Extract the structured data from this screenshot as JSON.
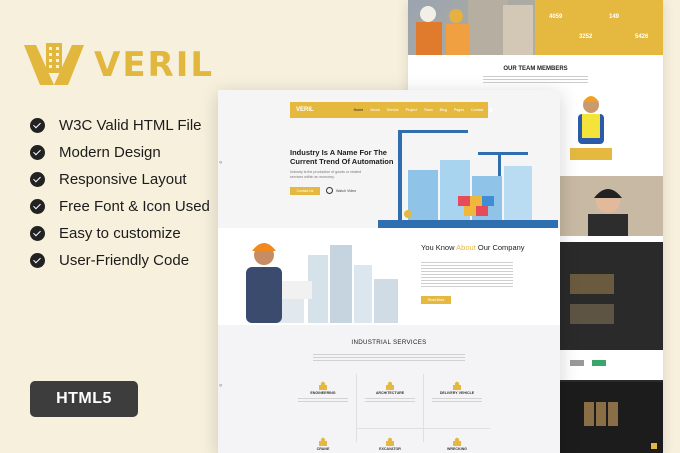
{
  "brand": {
    "name": "VERIL",
    "accent": "#e5b940",
    "logo_color": "#e2b73e"
  },
  "features": [
    {
      "label": "W3C Valid HTML File",
      "icon": "check-circle-icon"
    },
    {
      "label": "Modern Design",
      "icon": "check-circle-icon"
    },
    {
      "label": "Responsive Layout",
      "icon": "check-circle-icon"
    },
    {
      "label": "Free Font & Icon Used",
      "icon": "check-circle-icon"
    },
    {
      "label": "Easy to customize",
      "icon": "check-circle-icon"
    },
    {
      "label": "User-Friendly Code",
      "icon": "check-circle-icon"
    }
  ],
  "badge": "HTML5",
  "preview": {
    "nav": {
      "logo": "VERIL",
      "items": [
        "Home",
        "About",
        "Service",
        "Project",
        "Team",
        "Blog",
        "Pages",
        "Contact"
      ]
    },
    "hero": {
      "title": "Industry Is A Name For The Current Trend Of Automation",
      "text": "Industry is the production of goods or related services within an economy.",
      "button": "Contact Us",
      "video": "Watch Video"
    },
    "about": {
      "title_pre": "You Know ",
      "title_hl": "About",
      "title_post": " Our Company",
      "button": "Read More"
    },
    "services": {
      "title": "INDUSTRIAL SERVICES",
      "items": [
        {
          "name": "ENGINEERING",
          "icon": "engineer-icon"
        },
        {
          "name": "ARCHITECTURE",
          "icon": "architecture-icon"
        },
        {
          "name": "DELIVERY VEHICLE",
          "icon": "delivery-icon"
        },
        {
          "name": "CRANE",
          "icon": "crane-icon"
        },
        {
          "name": "EXCAVATOR",
          "icon": "excavator-icon"
        },
        {
          "name": "WRECKING",
          "icon": "wrecking-icon"
        }
      ]
    }
  },
  "back_page": {
    "stats": [
      "4059",
      "149",
      "3252",
      "5426"
    ],
    "team_title": "OUR TEAM MEMBERS"
  }
}
